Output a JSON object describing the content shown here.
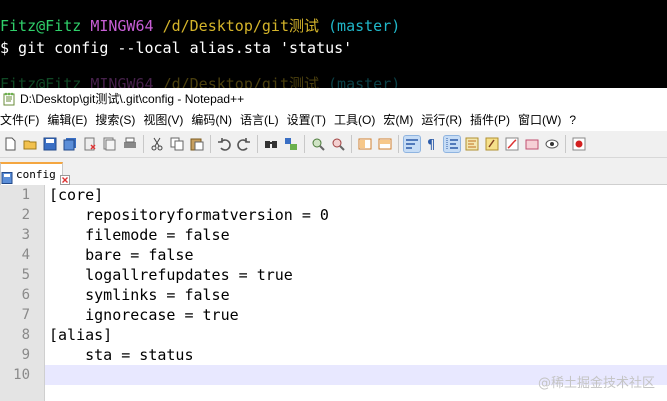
{
  "terminal": {
    "prompt1": {
      "user": "Fitz@Fitz",
      "system": "MINGW64",
      "path": "/d/Desktop/git测试",
      "branch": "(master)"
    },
    "command": "$ git config --local alias.sta 'status'",
    "prompt2": {
      "user": "Fitz@Fitz",
      "system": "MINGW64",
      "path": "/d/Desktop/git测试",
      "branch": "(master)"
    }
  },
  "window": {
    "title": "D:\\Desktop\\git测试\\.git\\config - Notepad++"
  },
  "menu": {
    "items": [
      "文件(F)",
      "编辑(E)",
      "搜索(S)",
      "视图(V)",
      "编码(N)",
      "语言(L)",
      "设置(T)",
      "工具(O)",
      "宏(M)",
      "运行(R)",
      "插件(P)",
      "窗口(W)",
      "?"
    ]
  },
  "toolbar": {
    "icons": [
      "new-file-icon",
      "open-file-icon",
      "save-icon",
      "save-all-icon",
      "close-icon",
      "close-all-icon",
      "print-icon",
      "cut-icon",
      "copy-icon",
      "paste-icon",
      "undo-icon",
      "redo-icon",
      "find-icon",
      "replace-icon",
      "zoom-in-icon",
      "zoom-out-icon",
      "sync-vertical-icon",
      "sync-horizontal-icon",
      "word-wrap-icon",
      "show-all-chars-icon",
      "indent-guide-icon",
      "doc-map-icon",
      "function-list-icon",
      "folder-workspace-icon",
      "monitor-icon",
      "record-macro-icon"
    ]
  },
  "tabs": [
    {
      "label": "config",
      "active": true
    }
  ],
  "editor": {
    "lines": [
      {
        "num": "1",
        "text": "[core]"
      },
      {
        "num": "2",
        "text": "    repositoryformatversion = 0"
      },
      {
        "num": "3",
        "text": "    filemode = false"
      },
      {
        "num": "4",
        "text": "    bare = false"
      },
      {
        "num": "5",
        "text": "    logallrefupdates = true"
      },
      {
        "num": "6",
        "text": "    symlinks = false"
      },
      {
        "num": "7",
        "text": "    ignorecase = true"
      },
      {
        "num": "8",
        "text": "[alias]"
      },
      {
        "num": "9",
        "text": "    sta = status"
      },
      {
        "num": "10",
        "text": ""
      }
    ],
    "current_line": 10
  },
  "watermark": "@稀土掘金技术社区",
  "colors": {
    "terminal_user": "#2fd06a",
    "terminal_system": "#c85ed6",
    "terminal_path": "#d4b42a",
    "terminal_branch": "#20b7c9",
    "tab_accent": "#f4a640",
    "current_line_bg": "#e8e8ff"
  }
}
